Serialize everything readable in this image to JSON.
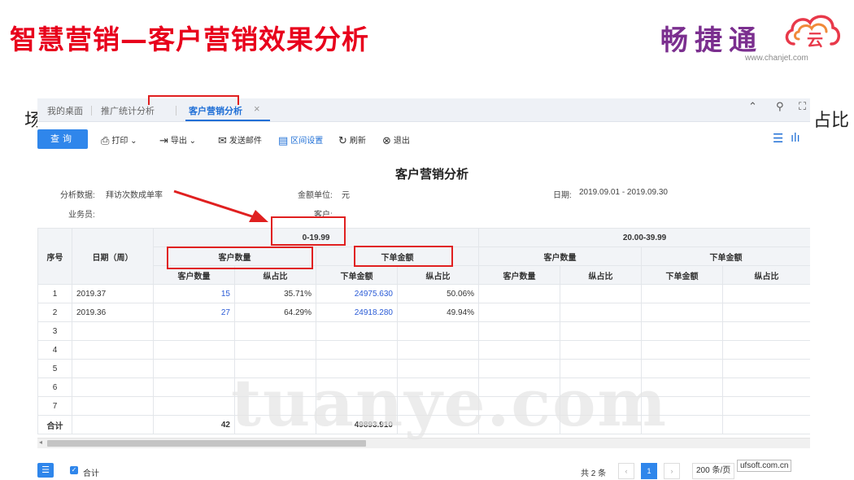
{
  "slide": {
    "title": "智慧营销—客户营销效果分析",
    "logo_text": "畅捷通",
    "logo_url": "www.chanjet.com",
    "bg_left_char": "场",
    "bg_right_char": "占比"
  },
  "tabs": [
    {
      "label": "我的桌面"
    },
    {
      "label": "推广统计分析"
    },
    {
      "label": "客户营销分析"
    }
  ],
  "toolbar": {
    "query": "查询",
    "print": "打印",
    "export": "导出",
    "email": "发送邮件",
    "range": "区间设置",
    "refresh": "刷新",
    "exit": "退出"
  },
  "report": {
    "title": "客户营销分析",
    "data_label": "分析数据:",
    "data_value": "拜访次数成单率",
    "unit_label": "金额单位:",
    "unit_value": "元",
    "date_label": "日期:",
    "date_value": "2019.09.01 - 2019.09.30",
    "salesman_label": "业务员:",
    "customer_label": "客户:"
  },
  "table": {
    "col_seq": "序号",
    "col_date": "日期（周）",
    "range1": "0-19.99",
    "range2": "20.00-39.99",
    "group_customers": "客户数量",
    "group_amount": "下单金额",
    "sub_customers": "客户数量",
    "sub_ratio": "纵占比",
    "sub_amount": "下单金额",
    "rows": [
      {
        "seq": "1",
        "date": "2019.37",
        "cust": "15",
        "cust_pct": "35.71%",
        "amount": "24975.630",
        "amount_pct": "50.06%"
      },
      {
        "seq": "2",
        "date": "2019.36",
        "cust": "27",
        "cust_pct": "64.29%",
        "amount": "24918.280",
        "amount_pct": "49.94%"
      },
      {
        "seq": "3",
        "date": "",
        "cust": "",
        "cust_pct": "",
        "amount": "",
        "amount_pct": ""
      },
      {
        "seq": "4",
        "date": "",
        "cust": "",
        "cust_pct": "",
        "amount": "",
        "amount_pct": ""
      },
      {
        "seq": "5",
        "date": "",
        "cust": "",
        "cust_pct": "",
        "amount": "",
        "amount_pct": ""
      },
      {
        "seq": "6",
        "date": "",
        "cust": "",
        "cust_pct": "",
        "amount": "",
        "amount_pct": ""
      },
      {
        "seq": "7",
        "date": "",
        "cust": "",
        "cust_pct": "",
        "amount": "",
        "amount_pct": ""
      }
    ],
    "total_label": "合计",
    "total_cust": "42",
    "total_amount": "49893.910"
  },
  "footer": {
    "sum_checkbox": "合计",
    "total_text": "共 2 条",
    "page": "1",
    "page_size": "200 条/页",
    "ufsoft": "ufsoft.com.cn"
  },
  "watermark": "tuanye.com",
  "colors": {
    "title_red": "#e8001c",
    "accent_blue": "#2f86eb",
    "annotation_red": "#e02020"
  }
}
